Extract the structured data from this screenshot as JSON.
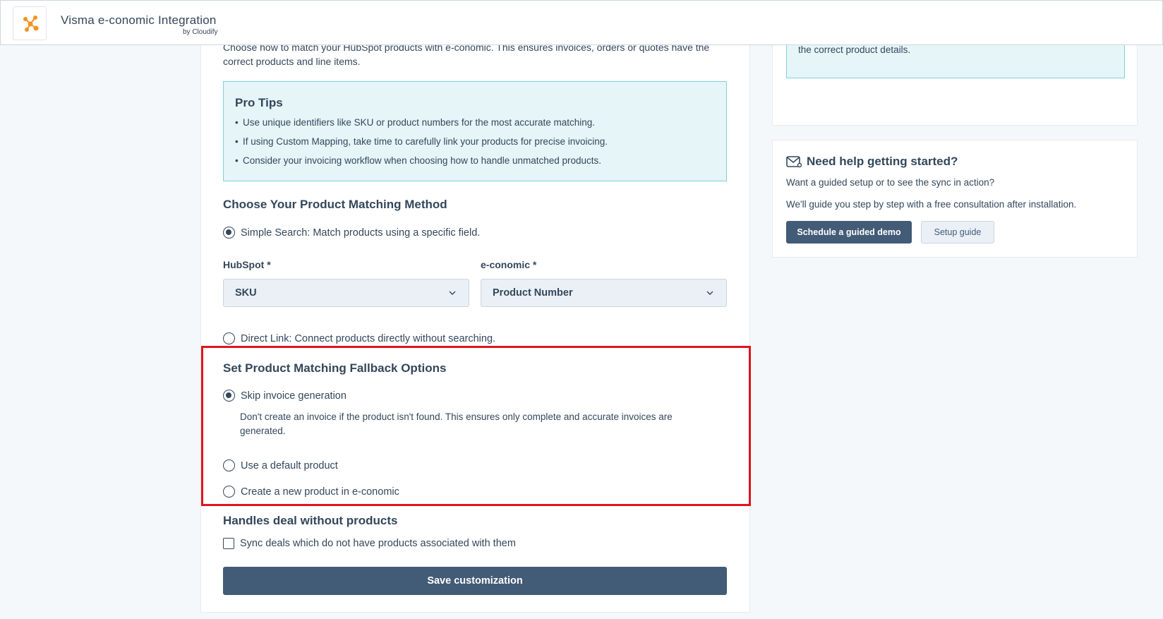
{
  "header": {
    "app_title": "Visma e-conomic Integration",
    "app_subtitle": "by Cloudify",
    "logo_icon": "network-nodes-icon",
    "logo_color": "#f29320"
  },
  "main": {
    "intro": "Choose how to match your HubSpot products with e-conomic. This ensures invoices, orders or quotes have the correct products and line items.",
    "pro_tips": {
      "title": "Pro Tips",
      "items": [
        "Use unique identifiers like SKU or product numbers for the most accurate matching.",
        "If using Custom Mapping, take time to carefully link your products for precise invoicing.",
        "Consider your invoicing workflow when choosing how to handle unmatched products."
      ]
    },
    "matching_method": {
      "title": "Choose Your Product Matching Method",
      "simple_search_label": "Simple Search: Match products using a specific field.",
      "hubspot_label": "HubSpot *",
      "hubspot_value": "SKU",
      "economic_label": "e-conomic *",
      "economic_value": "Product Number",
      "direct_link_label": "Direct Link: Connect products directly without searching."
    },
    "fallback": {
      "title": "Set Product Matching Fallback Options",
      "skip_label": "Skip invoice generation",
      "skip_description": "Don't create an invoice if the product isn't found. This ensures only complete and accurate invoices are generated.",
      "default_product_label": "Use a default product",
      "create_product_label": "Create a new product in e-conomic"
    },
    "no_products": {
      "title": "Handles deal without products",
      "checkbox_label": "Sync deals which do not have products associated with them"
    },
    "save_label": "Save customization"
  },
  "right": {
    "info_text": "the correct product details.",
    "help": {
      "title": "Need help getting started?",
      "p1": "Want a guided setup or to see the sync in action?",
      "p2": "We'll guide you step by step with a free consultation after installation.",
      "demo_label": "Schedule a guided demo",
      "guide_label": "Setup guide"
    }
  },
  "colors": {
    "primary": "#425b76",
    "text": "#33475b",
    "tip_bg": "#e5f5f8",
    "tip_border": "#7fd1de",
    "highlight": "#e0141e"
  }
}
